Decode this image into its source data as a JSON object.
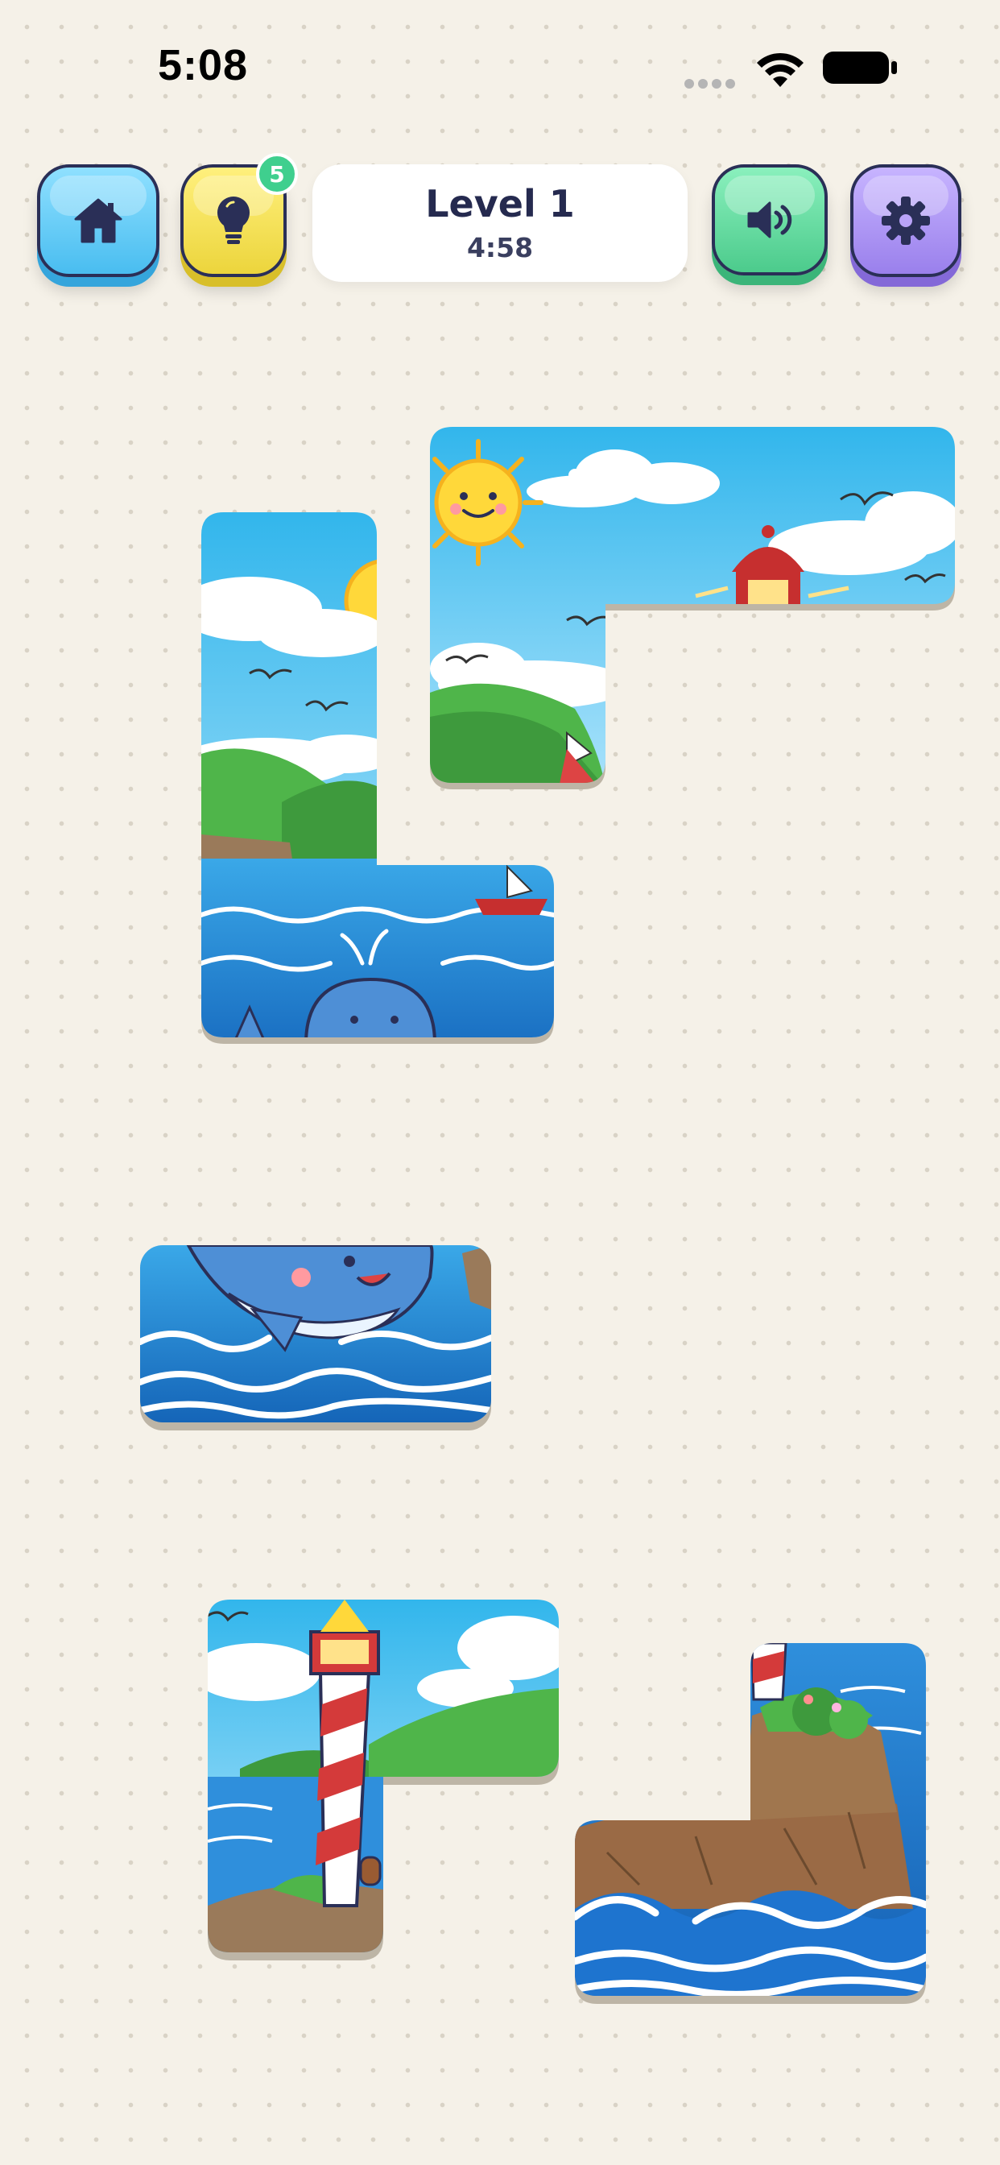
{
  "status_bar": {
    "time": "5:08"
  },
  "header": {
    "home_icon": "home-icon",
    "hint_icon": "lightbulb-icon",
    "hint_count": "5",
    "level_label": "Level 1",
    "timer": "4:58",
    "sound_icon": "speaker-icon",
    "settings_icon": "gear-icon"
  },
  "colors": {
    "background": "#f5f1e8",
    "home_button": "#49bdf0",
    "hint_button": "#ecd53c",
    "hint_badge": "#3fcf8e",
    "sound_button": "#4ccb8c",
    "settings_button": "#9a80ec",
    "icon_dark": "#2a2f57"
  },
  "pieces": [
    {
      "id": "sun-sky-piece",
      "content": "sun, clouds, seagulls, lighthouse lamp, sailboat mast"
    },
    {
      "id": "cliff-whale-piece",
      "content": "sun, clouds, seagulls, green hills, cliff, sea, whale, sailboat"
    },
    {
      "id": "whale-waves-piece",
      "content": "whale jumping in waves"
    },
    {
      "id": "lighthouse-piece",
      "content": "lighthouse, hills, sea, rock"
    },
    {
      "id": "rock-waves-piece",
      "content": "lighthouse base, bushes, rocky island, crashing waves"
    }
  ]
}
